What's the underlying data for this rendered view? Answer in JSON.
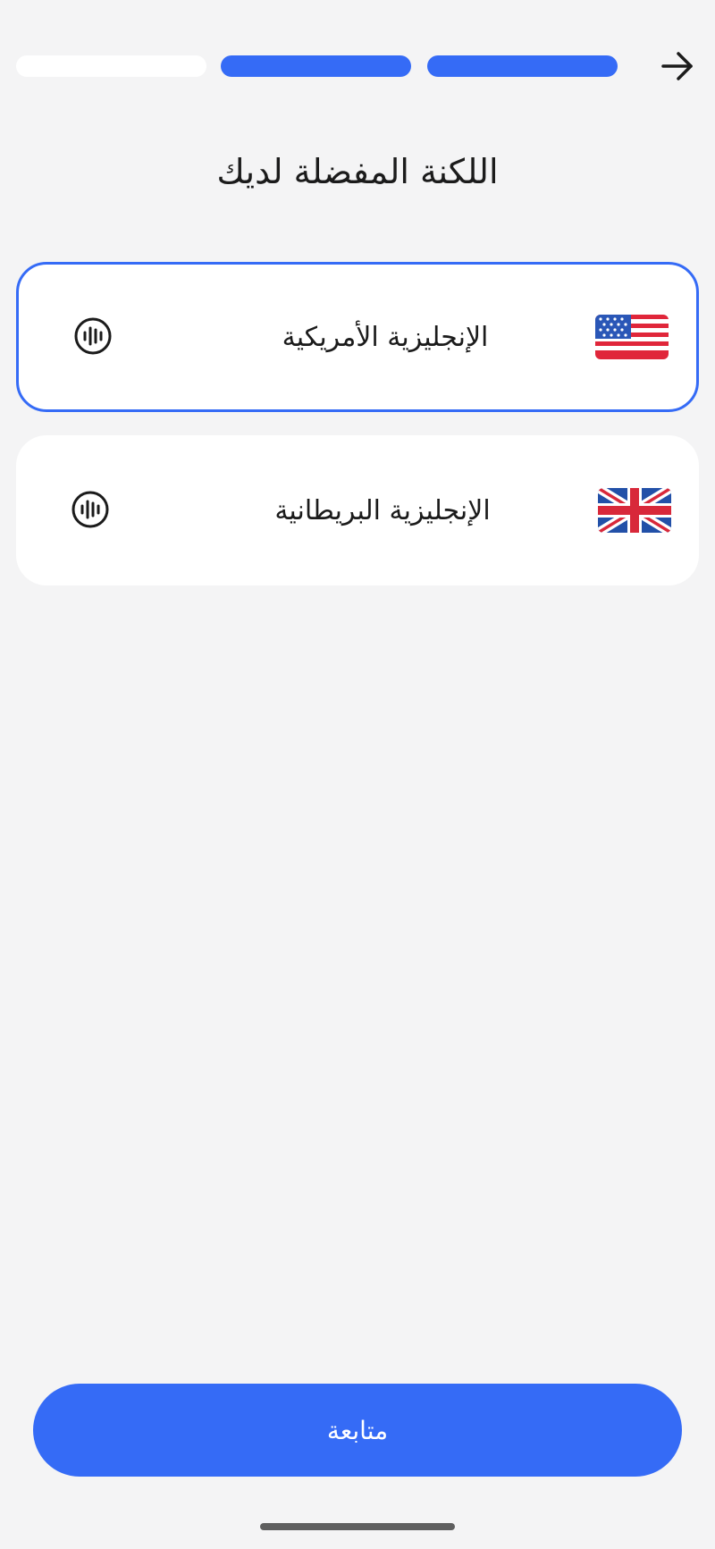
{
  "progress": {
    "total_steps": 3,
    "completed_steps": 2,
    "active_color": "#356bf6",
    "inactive_color": "#ffffff"
  },
  "header": {
    "back_icon": "arrow-right-icon"
  },
  "page": {
    "title": "اللكنة المفضلة لديك"
  },
  "options": [
    {
      "label": "الإنجليزية الأمريكية",
      "flag_icon": "us-flag-icon",
      "audio_icon": "audio-wave-icon",
      "selected": true
    },
    {
      "label": "الإنجليزية البريطانية",
      "flag_icon": "uk-flag-icon",
      "audio_icon": "audio-wave-icon",
      "selected": false
    }
  ],
  "footer": {
    "continue_label": "متابعة"
  },
  "colors": {
    "accent": "#356bf6",
    "background": "#f4f4f5",
    "card": "#ffffff"
  }
}
